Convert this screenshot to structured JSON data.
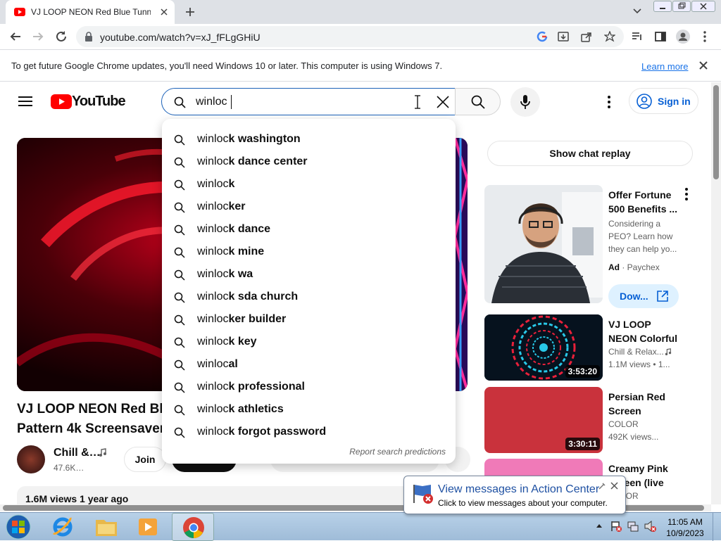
{
  "browser": {
    "tab_title": "VJ LOOP NEON Red Blue Tunnel",
    "url": "youtube.com/watch?v=xJ_fFLgGHiU",
    "infobar_message": "To get future Google Chrome updates, you'll need Windows 10 or later. This computer is using Windows 7.",
    "infobar_link": "Learn more"
  },
  "youtube": {
    "logo_text": "YouTube",
    "search_value": "winloc",
    "sign_in": "Sign in",
    "suggestions": [
      {
        "typed": "winloc",
        "rest": "k washington"
      },
      {
        "typed": "winloc",
        "rest": "k dance center"
      },
      {
        "typed": "winloc",
        "rest": "k"
      },
      {
        "typed": "winloc",
        "rest": "ker"
      },
      {
        "typed": "winloc",
        "rest": "k dance"
      },
      {
        "typed": "winloc",
        "rest": "k mine"
      },
      {
        "typed": "winloc",
        "rest": "k wa"
      },
      {
        "typed": "winloc",
        "rest": "k sda church"
      },
      {
        "typed": "winloc",
        "rest": "ker builder"
      },
      {
        "typed": "winloc",
        "rest": "k key"
      },
      {
        "typed": "winloc",
        "rest": "al"
      },
      {
        "typed": "winloc",
        "rest": "k professional"
      },
      {
        "typed": "winloc",
        "rest": "k athletics"
      },
      {
        "typed": "winloc",
        "rest": "k forgot password"
      }
    ],
    "report_predictions": "Report search predictions",
    "video": {
      "title_line1": "VJ LOOP NEON Red Blue",
      "title_line2": "Pattern 4k Screensaver",
      "channel": "Chill &…",
      "subscribers": "47.6K…",
      "join": "Join",
      "views": "1.6M views  1 year ago"
    },
    "sidebar": {
      "show_chat_replay": "Show chat replay",
      "items": [
        {
          "title": "Offer Fortune 500 Benefits ...",
          "line1": "Considering a",
          "line2": "PEO? Learn how",
          "line3": "they can help yo...",
          "ad": "Ad",
          "advertiser": "Paychex",
          "cta": "Dow..."
        },
        {
          "title": "VJ LOOP NEON Colorful Tunn...",
          "channel": "Chill & Relax...",
          "meta": "1.1M views  • 1...",
          "duration": "3:53:20"
        },
        {
          "title": "Persian Red Screen",
          "channel": "COLOR",
          "meta": "492K views...",
          "duration": "3:30:11"
        },
        {
          "title": "Creamy Pink Screen (live 0...",
          "channel": "COLOR"
        }
      ]
    }
  },
  "notification": {
    "title": "View messages in Action Center",
    "subtitle": "Click to view messages about your computer."
  },
  "taskbar": {
    "time": "11:05 AM",
    "date": "10/9/2023"
  }
}
